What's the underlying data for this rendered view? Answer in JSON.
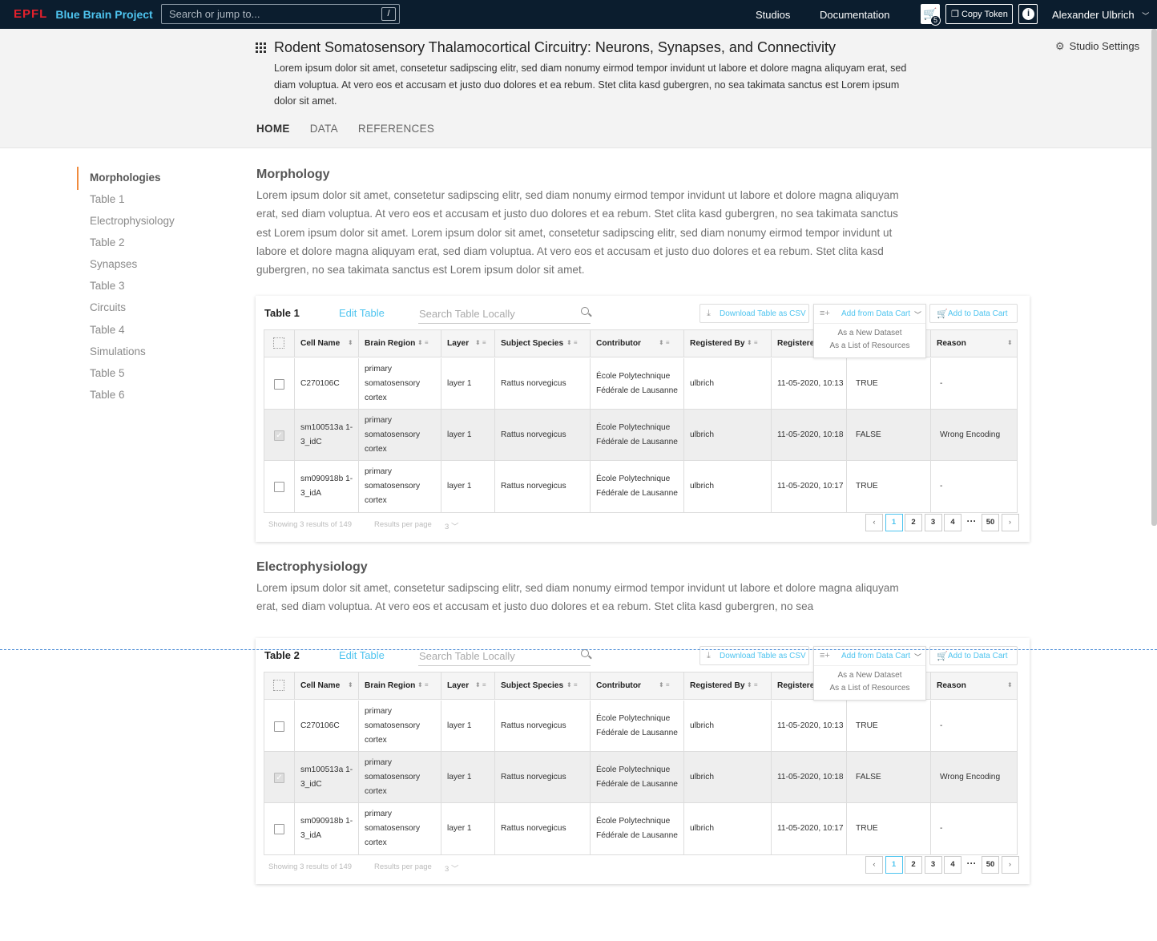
{
  "topbar": {
    "logo_epfl": "EPFL",
    "logo_bbp": "Blue Brain Project",
    "search_placeholder": "Search or jump to...",
    "search_key": "/",
    "studios": "Studios",
    "documentation": "Documentation",
    "cart_count": "5",
    "copy_token": "Copy Token",
    "info": "i",
    "user": "Alexander Ulbrich"
  },
  "header": {
    "title": "Rodent Somatosensory Thalamocortical Circuitry: Neurons, Synapses, and Connectivity",
    "description": "Lorem ipsum dolor sit amet, consetetur sadipscing elitr, sed diam nonumy eirmod tempor invidunt ut labore et dolore magna aliquyam erat, sed diam voluptua. At vero eos et accusam et justo duo dolores et ea rebum. Stet clita kasd gubergren, no sea takimata sanctus est Lorem ipsum dolor sit amet.",
    "settings": "Studio Settings",
    "tabs": [
      "HOME",
      "DATA",
      "REFERENCES"
    ]
  },
  "sidebar": {
    "items": [
      "Morphologies",
      "Table 1",
      "Electrophysiology",
      "Table 2",
      "Synapses",
      "Table 3",
      "Circuits",
      "Table 4",
      "Simulations",
      "Table 5",
      "Table 6"
    ]
  },
  "sections": [
    {
      "title": "Morphology",
      "text": "Lorem ipsum dolor sit amet, consetetur sadipscing elitr, sed diam nonumy eirmod tempor invidunt ut labore et dolore magna aliquyam erat, sed diam voluptua. At vero eos et accusam et justo duo dolores et ea rebum. Stet clita kasd gubergren, no sea takimata sanctus est Lorem ipsum dolor sit amet. Lorem ipsum dolor sit amet, consetetur sadipscing elitr, sed diam nonumy eirmod tempor invidunt ut labore et dolore magna aliquyam erat, sed diam voluptua. At vero eos et accusam et justo duo dolores et ea rebum. Stet clita kasd gubergren, no sea takimata sanctus est Lorem ipsum dolor sit amet."
    },
    {
      "title": "Electrophysiology",
      "text": "Lorem ipsum dolor sit amet, consetetur sadipscing elitr, sed diam nonumy eirmod tempor invidunt ut labore et dolore magna aliquyam erat, sed diam voluptua. At vero eos et accusam et justo duo dolores et ea rebum. Stet clita kasd gubergren, no sea"
    }
  ],
  "table_toolbar": {
    "edit": "Edit Table",
    "search_placeholder": "Search Table Locally",
    "download": "Download Table as CSV",
    "add_from_cart": "Add from Data Cart",
    "add_to_cart": "Add to Data Cart",
    "dropdown_options": [
      "As a New Dataset",
      "As a List of Resources"
    ]
  },
  "table_columns": [
    "Cell Name",
    "Brain Region",
    "Layer",
    "Subject Species",
    "Contributor",
    "Registered By",
    "Registered",
    "",
    "Reason"
  ],
  "tables": [
    {
      "title": "Table 1",
      "rows": [
        {
          "selected": false,
          "cells": [
            "C270106C",
            "primary somatosensory cortex",
            "layer 1",
            "Rattus norvegicus",
            "École Polytechnique Fédérale de Lausanne",
            "ulbrich",
            "11-05-2020, 10:13",
            "TRUE",
            "-"
          ]
        },
        {
          "selected": true,
          "cells": [
            "sm100513a 1-3_idC",
            "primary somatosensory cortex",
            "layer 1",
            "Rattus norvegicus",
            "École Polytechnique Fédérale de Lausanne",
            "ulbrich",
            "11-05-2020, 10:18",
            "FALSE",
            "Wrong Encoding"
          ]
        },
        {
          "selected": false,
          "cells": [
            "sm090918b 1-3_idA",
            "primary somatosensory cortex",
            "layer 1",
            "Rattus norvegicus",
            "École Polytechnique Fédérale de Lausanne",
            "ulbrich",
            "11-05-2020, 10:17",
            "TRUE",
            "-"
          ]
        }
      ],
      "showing": "Showing 3 results of 149",
      "per_page_label": "Results per page",
      "per_page": "3",
      "pages": [
        "1",
        "2",
        "3",
        "4",
        "···",
        "50"
      ]
    },
    {
      "title": "Table 2",
      "rows": [
        {
          "selected": false,
          "cells": [
            "C270106C",
            "primary somatosensory cortex",
            "layer 1",
            "Rattus norvegicus",
            "École Polytechnique Fédérale de Lausanne",
            "ulbrich",
            "11-05-2020, 10:13",
            "TRUE",
            "-"
          ]
        },
        {
          "selected": true,
          "cells": [
            "sm100513a 1-3_idC",
            "primary somatosensory cortex",
            "layer 1",
            "Rattus norvegicus",
            "École Polytechnique Fédérale de Lausanne",
            "ulbrich",
            "11-05-2020, 10:18",
            "FALSE",
            "Wrong Encoding"
          ]
        },
        {
          "selected": false,
          "cells": [
            "sm090918b 1-3_idA",
            "primary somatosensory cortex",
            "layer 1",
            "Rattus norvegicus",
            "École Polytechnique Fédérale de Lausanne",
            "ulbrich",
            "11-05-2020, 10:17",
            "TRUE",
            "-"
          ]
        }
      ],
      "showing": "Showing 3 results of 149",
      "per_page_label": "Results per page",
      "per_page": "3",
      "pages": [
        "1",
        "2",
        "3",
        "4",
        "···",
        "50"
      ]
    }
  ],
  "colors": {
    "topbar": "#0b1d2e",
    "accent": "#4ec4ef",
    "epfl_red": "#e4202c",
    "sidebar_marker": "#f08b3e"
  }
}
